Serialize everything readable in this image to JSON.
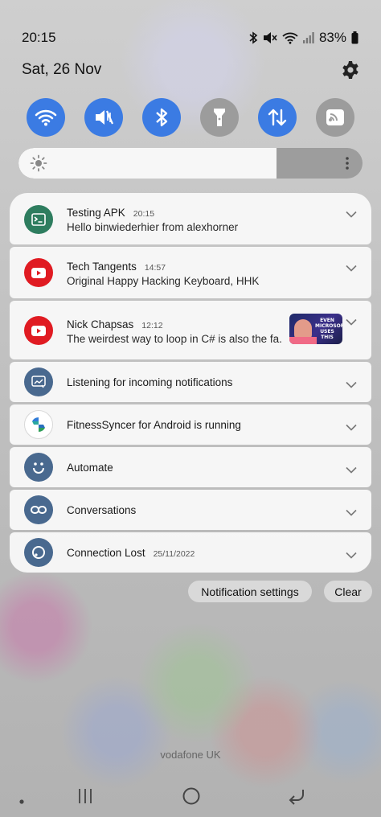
{
  "status": {
    "time": "20:15",
    "battery": "83%",
    "icons": [
      "bluetooth-icon",
      "mute-icon",
      "wifi-icon",
      "signal-icon",
      "battery-icon"
    ]
  },
  "header": {
    "date": "Sat, 26 Nov",
    "settings_icon": "gear-icon"
  },
  "quick_settings": [
    {
      "name": "wifi",
      "icon": "wifi-icon",
      "active": true
    },
    {
      "name": "sound",
      "icon": "mute-icon",
      "active": true
    },
    {
      "name": "bluetooth",
      "icon": "bluetooth-icon",
      "active": true
    },
    {
      "name": "flashlight",
      "icon": "flashlight-icon",
      "active": false
    },
    {
      "name": "mobile-data",
      "icon": "data-arrows-icon",
      "active": true
    },
    {
      "name": "cast",
      "icon": "cast-icon",
      "active": false
    }
  ],
  "brightness": {
    "level": 0.75
  },
  "notifications": [
    {
      "app": "Testing APK",
      "time": "20:15",
      "text": "Hello binwiederhier from alexhorner",
      "icon": "terminal-icon",
      "color": "#2e7d5f"
    },
    {
      "app": "Tech Tangents",
      "time": "14:57",
      "text": "Original Happy Hacking Keyboard, HHK",
      "icon": "youtube-icon",
      "color": "#e01b22"
    },
    {
      "app": "Nick Chapsas",
      "time": "12:12",
      "text": "The weirdest way to loop in C# is also the fa...",
      "icon": "youtube-icon",
      "color": "#e01b22",
      "thumbnail_caption": [
        "EVEN",
        "MICROSOFT",
        "USES THIS"
      ]
    },
    {
      "text": "Listening for incoming notifications",
      "icon": "message-icon",
      "color": "#49698f"
    },
    {
      "text": "FitnessSyncer for Android is running",
      "icon": "fitnesssyncer-icon",
      "color": "#ffffff"
    },
    {
      "text": "Automate",
      "icon": "smiley-icon",
      "color": "#49698f"
    },
    {
      "text": "Conversations",
      "icon": "link-icon",
      "color": "#49698f"
    },
    {
      "text": "Connection Lost",
      "time": "25/11/2022",
      "icon": "circle-icon",
      "color": "#49698f"
    }
  ],
  "actions": {
    "settings_label": "Notification settings",
    "clear_label": "Clear"
  },
  "carrier": "vodafone UK",
  "colors": {
    "accent": "#3b7be3",
    "tile_off": "#9c9c9c",
    "youtube": "#e01b22",
    "system_icon": "#49698f"
  }
}
